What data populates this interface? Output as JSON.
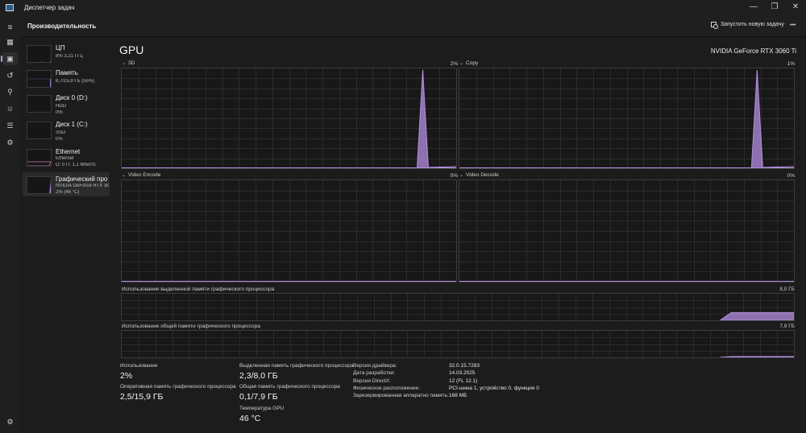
{
  "window": {
    "title": "Диспетчер задач",
    "minimize_glyph": "—",
    "maximize_glyph": "❐",
    "close_glyph": "✕"
  },
  "header": {
    "page_title": "Производительность",
    "run_task_label": "Запустить новую задачу",
    "more_glyph": "•••"
  },
  "nav": {
    "items": [
      {
        "icon": "hamburger-icon",
        "glyph": "≡"
      },
      {
        "icon": "processes-icon",
        "glyph": "▦"
      },
      {
        "icon": "performance-icon",
        "glyph": "▣",
        "active": true
      },
      {
        "icon": "app-history-icon",
        "glyph": "↺"
      },
      {
        "icon": "startup-apps-icon",
        "glyph": "⚲"
      },
      {
        "icon": "users-icon",
        "glyph": "☺"
      },
      {
        "icon": "details-icon",
        "glyph": "☰"
      },
      {
        "icon": "services-icon",
        "glyph": "⚙"
      }
    ],
    "settings_glyph": "⚙"
  },
  "resources": [
    {
      "name": "ЦП",
      "sub1": "8%  3,21 ГГц",
      "sub2": "",
      "color": "#3aa3b8"
    },
    {
      "name": "Память",
      "sub1": "8,7/15,9 ГБ (55%)",
      "sub2": "",
      "color": "#8e7fd1"
    },
    {
      "name": "Диск 0 (D:)",
      "sub1": "HDD",
      "sub2": "0%",
      "color": "#6aa84f"
    },
    {
      "name": "Диск 1 (C:)",
      "sub1": "SSD",
      "sub2": "0%",
      "color": "#6aa84f"
    },
    {
      "name": "Ethernet",
      "sub1": "Ethernet",
      "sub2": "О: 0 П: 1,1 Мбит/с",
      "color": "#c080b0"
    },
    {
      "name": "Графический про",
      "sub1": "NVIDIA GeForce RTX 306",
      "sub2": "2% (46 °C)",
      "color": "#a27fd8",
      "active": true
    }
  ],
  "gpu": {
    "title": "GPU",
    "model": "NVIDIA GeForce RTX 3060 Ti",
    "graph_color": "#b38fe0",
    "engines": [
      {
        "name": "3D",
        "pct": "2%",
        "spike_at": 0.9,
        "spike_level": 1.0
      },
      {
        "name": "Copy",
        "pct": "1%",
        "spike_at": 0.89,
        "spike_level": 1.0
      },
      {
        "name": "Video Encode",
        "pct": "0%",
        "spike_at": null,
        "spike_level": 0
      },
      {
        "name": "Video Decode",
        "pct": "0%",
        "spike_at": null,
        "spike_level": 0
      }
    ],
    "dedicated_mem": {
      "label": "Использование выделенной памяти графического процессора",
      "max": "8,0 ГБ",
      "level": 0.29
    },
    "shared_mem": {
      "label": "Использование общей памяти графического процессора",
      "max": "7,9 ГБ",
      "level": 0.01
    }
  },
  "stats": {
    "usage_label": "Использование",
    "usage_value": "2%",
    "dedicated_label": "Выделенная память графического процессора",
    "dedicated_value": "2,3/8,0 ГБ",
    "ram_label": "Оперативная память графического процессора",
    "ram_value": "2,5/15,9 ГБ",
    "shared_label": "Общая память графического процессора",
    "shared_value": "0,1/7,9 ГБ",
    "temp_label": "Температура GPU",
    "temp_value": "46 °C"
  },
  "info": [
    {
      "key": "Версия драйвера:",
      "value": "32.0.15.7283"
    },
    {
      "key": "Дата разработки:",
      "value": "14.03.2025"
    },
    {
      "key": "Версия DirectX:",
      "value": "12 (FL 12.1)"
    },
    {
      "key": "Физическое расположение:",
      "value": "PCI-шина 1, устройство 0, функция 0"
    },
    {
      "key": "Зарезервированная аппаратно память:",
      "value": "168 МБ"
    }
  ]
}
